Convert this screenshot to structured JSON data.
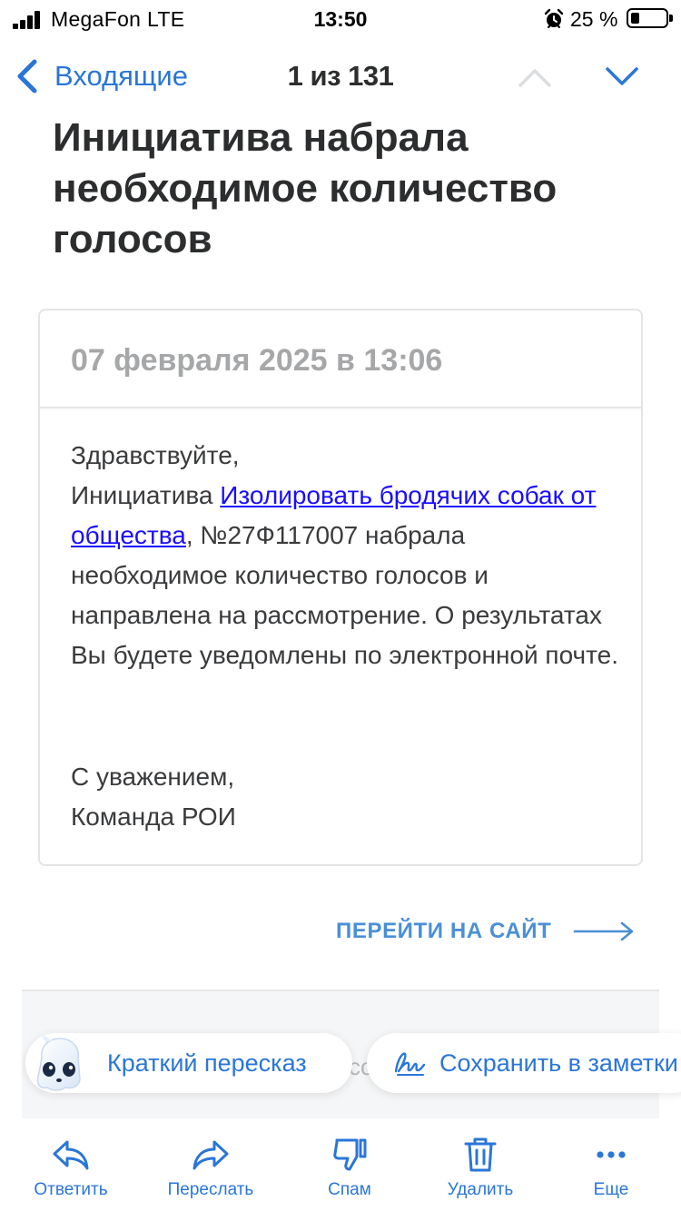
{
  "status_bar": {
    "carrier": "MegaFon  LTE",
    "time": "13:50",
    "battery_percent": "25 %",
    "battery_level": 0.25
  },
  "nav": {
    "back_label": "Входящие",
    "counter": "1 из 131"
  },
  "subject": "Инициатива набрала необходимое количество голосов",
  "card": {
    "date": "07 февраля 2025 в 13:06",
    "greeting": "Здравствуйте,",
    "body_prefix": "Инициатива ",
    "link_text": "Изолировать бродячих собак от общества",
    "body_suffix": ", №27Ф117007 набрала необходимое количество голосов и направлена на рассмотрение. О результатах Вы будете уведомлены по электронной почте.",
    "sign_line1": "С уважением,",
    "sign_line2": "Команда РОИ"
  },
  "goto_site_label": "ПЕРЕЙТИ НА САЙТ",
  "behind_text": "сс",
  "chips": {
    "summary_label": "Краткий пересказ",
    "notes_label": "Сохранить в заметки"
  },
  "toolbar": {
    "reply_label": "Ответить",
    "forward_label": "Переслать",
    "spam_label": "Спам",
    "delete_label": "Удалить",
    "more_label": "Еще"
  },
  "colors": {
    "accent": "#2a76d8",
    "link": "#1a0dff",
    "text": "#2c2d2e",
    "muted": "#a6a7a9"
  }
}
